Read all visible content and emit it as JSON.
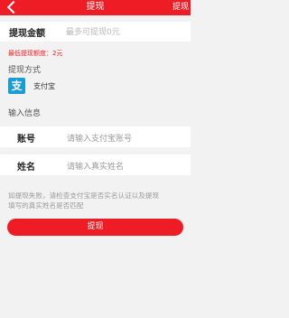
{
  "header": {
    "title": "提现",
    "right_label": "提现"
  },
  "amount": {
    "label": "提现金额",
    "placeholder": "最多可提现0元"
  },
  "min_note": "最低提现额度：2元",
  "method": {
    "section_label": "提现方式",
    "alipay_icon_glyph": "支",
    "alipay_label": "支付宝",
    "icon": "alipay-icon",
    "icon_color": "#1a9cd8"
  },
  "info": {
    "section_label": "输入信息",
    "account_label": "账号",
    "account_placeholder": "请输入支付宝账号",
    "name_label": "姓名",
    "name_placeholder": "请输入真实姓名"
  },
  "notice": {
    "line1": "如提现失败，请检查支付宝是否实名认证以及提现",
    "line2": "填写的真实姓名是否匹配"
  },
  "submit_label": "提现",
  "colors": {
    "accent": "#ee1c24",
    "background": "#f2f2f2"
  }
}
